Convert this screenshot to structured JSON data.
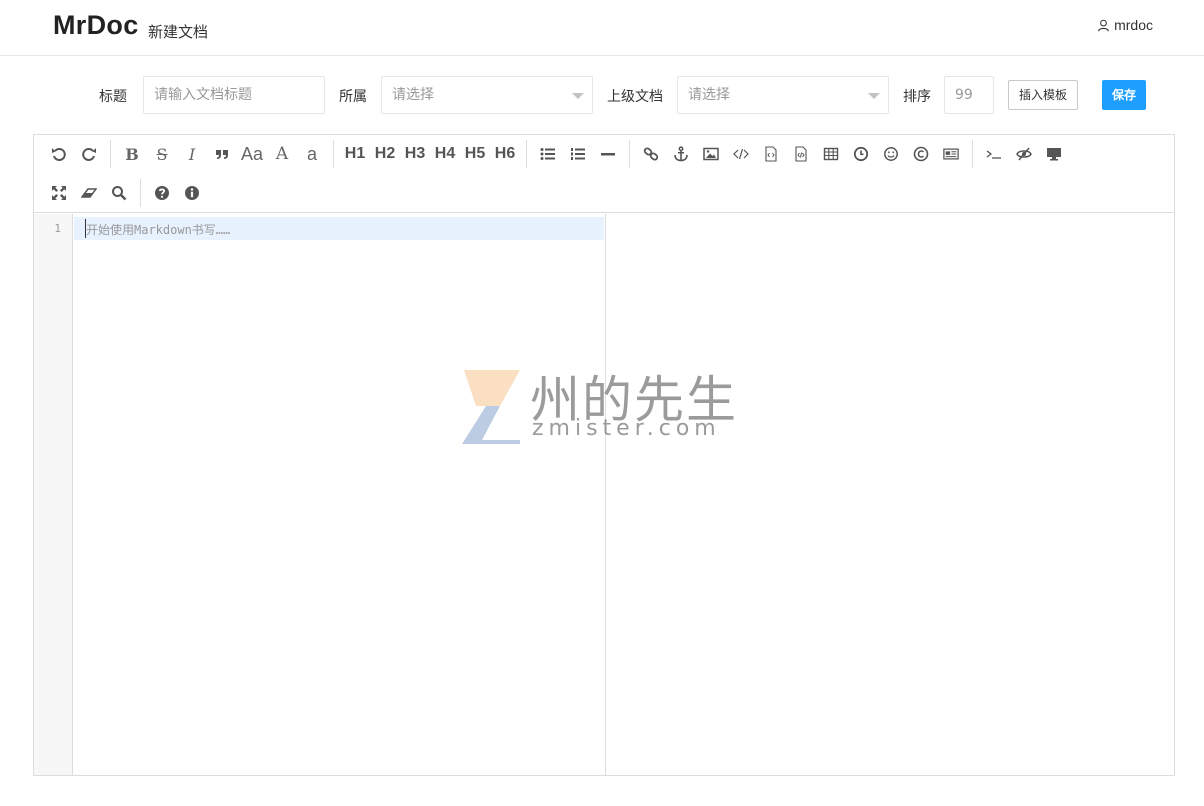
{
  "header": {
    "brand": "MrDoc",
    "subtitle": "新建文档",
    "user_icon": "user-icon",
    "username": "mrdoc"
  },
  "form": {
    "title_label": "标题",
    "title_placeholder": "请输入文档标题",
    "belong_label": "所属",
    "belong_value": "请选择",
    "parent_label": "上级文档",
    "parent_value": "请选择",
    "sort_label": "排序",
    "sort_placeholder": "99",
    "insert_template_label": "插入模板",
    "save_label": "保存"
  },
  "toolbar": {
    "row1": [
      {
        "icon": "undo-icon"
      },
      {
        "icon": "redo-icon"
      },
      {
        "icon": "bold-icon",
        "text": "B"
      },
      {
        "icon": "strikethrough-icon",
        "text": "S"
      },
      {
        "icon": "italic-icon",
        "text": "I"
      },
      {
        "icon": "quote-icon"
      },
      {
        "icon": "uppercase-icon",
        "text": "Aa"
      },
      {
        "icon": "font-a-icon",
        "text": "A"
      },
      {
        "icon": "lowercase-icon",
        "text": "a"
      },
      {
        "icon": "h1-icon",
        "text": "H1"
      },
      {
        "icon": "h2-icon",
        "text": "H2"
      },
      {
        "icon": "h3-icon",
        "text": "H3"
      },
      {
        "icon": "h4-icon",
        "text": "H4"
      },
      {
        "icon": "h5-icon",
        "text": "H5"
      },
      {
        "icon": "h6-icon",
        "text": "H6"
      },
      {
        "icon": "unordered-list-icon"
      },
      {
        "icon": "ordered-list-icon"
      },
      {
        "icon": "horizontal-rule-icon"
      },
      {
        "icon": "link-icon"
      },
      {
        "icon": "anchor-icon"
      },
      {
        "icon": "image-icon"
      },
      {
        "icon": "code-icon"
      },
      {
        "icon": "code-block-icon"
      },
      {
        "icon": "preformatted-icon"
      },
      {
        "icon": "table-icon"
      },
      {
        "icon": "clock-icon"
      },
      {
        "icon": "emoji-icon"
      },
      {
        "icon": "copyright-icon"
      },
      {
        "icon": "pagebreak-icon"
      },
      {
        "icon": "terminal-icon"
      },
      {
        "icon": "preview-toggle-icon"
      },
      {
        "icon": "desktop-icon"
      }
    ],
    "row2": [
      {
        "icon": "fullscreen-icon"
      },
      {
        "icon": "eraser-icon"
      },
      {
        "icon": "search-icon"
      },
      {
        "icon": "help-icon"
      },
      {
        "icon": "info-icon"
      }
    ],
    "h_labels": [
      "H1",
      "H2",
      "H3",
      "H4",
      "H5",
      "H6"
    ],
    "bold_text": "B",
    "strike_text": "S",
    "italic_text": "I",
    "uppercase_text": "Aa",
    "font_a_text": "A",
    "lowercase_text": "a"
  },
  "editor": {
    "line_number": "1",
    "placeholder": "开始使用Markdown书写……"
  },
  "watermark": {
    "cn": "州的先生",
    "en": "zmister.com"
  },
  "colors": {
    "accent": "#1e9fff",
    "active_line": "#e8f2ff",
    "border": "#dddddd"
  }
}
